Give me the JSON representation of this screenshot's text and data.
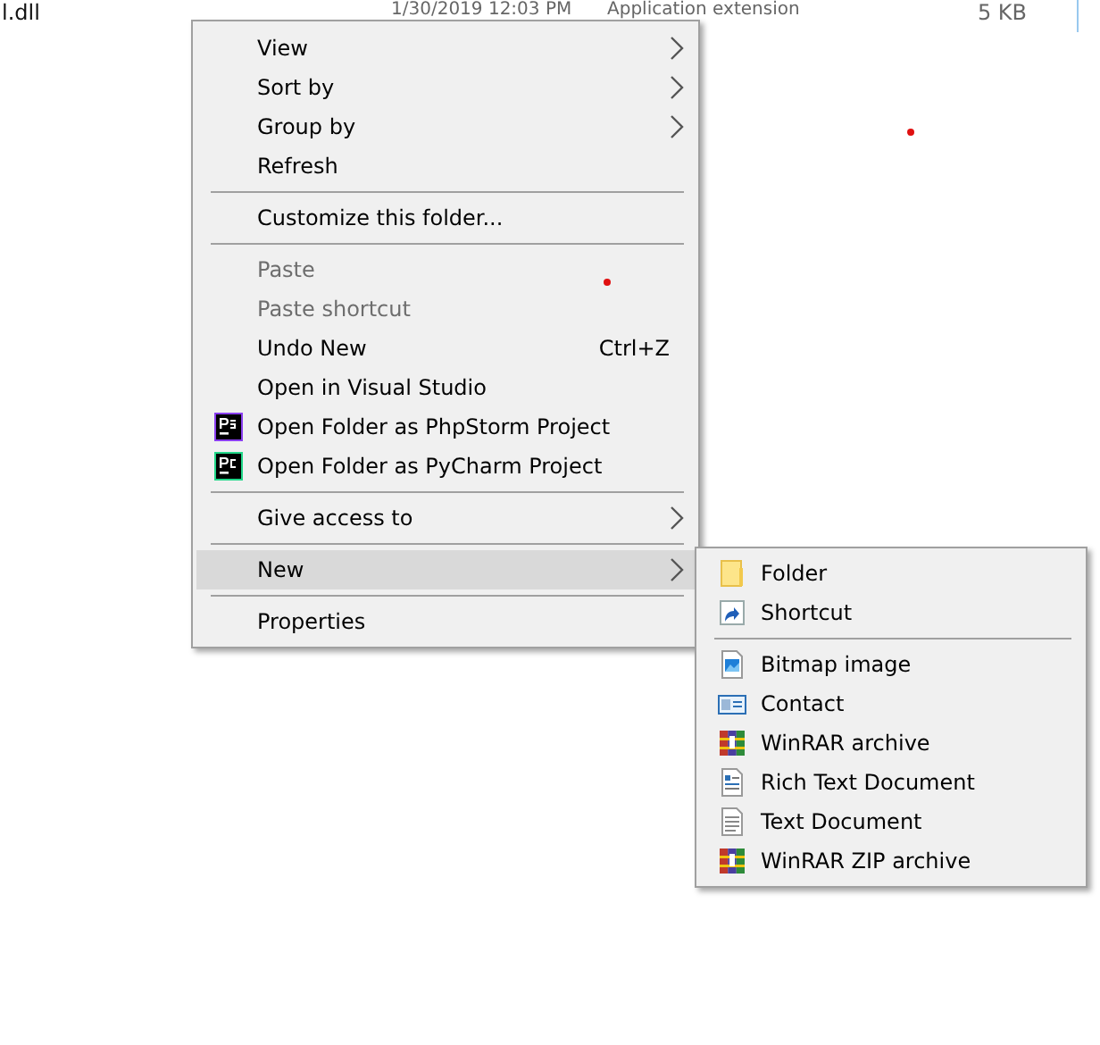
{
  "file_row": {
    "name": "l.dll",
    "date": "1/30/2019 12:03 PM",
    "type": "Application extension",
    "size": "5 KB"
  },
  "menu": {
    "items": [
      {
        "kind": "item",
        "label": "View",
        "submenu": true,
        "disabled": false,
        "selected": false
      },
      {
        "kind": "item",
        "label": "Sort by",
        "submenu": true,
        "disabled": false,
        "selected": false
      },
      {
        "kind": "item",
        "label": "Group by",
        "submenu": true,
        "disabled": false,
        "selected": false
      },
      {
        "kind": "item",
        "label": "Refresh",
        "submenu": false,
        "disabled": false,
        "selected": false
      },
      {
        "kind": "separator"
      },
      {
        "kind": "item",
        "label": "Customize this folder...",
        "submenu": false,
        "disabled": false,
        "selected": false
      },
      {
        "kind": "separator"
      },
      {
        "kind": "item",
        "label": "Paste",
        "submenu": false,
        "disabled": true,
        "selected": false
      },
      {
        "kind": "item",
        "label": "Paste shortcut",
        "submenu": false,
        "disabled": true,
        "selected": false
      },
      {
        "kind": "item",
        "label": "Undo New",
        "shortcut": "Ctrl+Z",
        "submenu": false,
        "disabled": false,
        "selected": false
      },
      {
        "kind": "item",
        "label": "Open in Visual Studio",
        "submenu": false,
        "disabled": false,
        "selected": false
      },
      {
        "kind": "item",
        "label": "Open Folder as PhpStorm Project",
        "submenu": false,
        "disabled": false,
        "selected": false
      },
      {
        "kind": "item",
        "label": "Open Folder as PyCharm Project",
        "submenu": false,
        "disabled": false,
        "selected": false
      },
      {
        "kind": "separator"
      },
      {
        "kind": "item",
        "label": "Give access to",
        "submenu": true,
        "disabled": false,
        "selected": false
      },
      {
        "kind": "separator"
      },
      {
        "kind": "item",
        "label": "New",
        "submenu": true,
        "disabled": false,
        "selected": true
      },
      {
        "kind": "separator"
      },
      {
        "kind": "item",
        "label": "Properties",
        "submenu": false,
        "disabled": false,
        "selected": false
      }
    ]
  },
  "submenu": {
    "items": [
      {
        "kind": "item",
        "label": "Folder"
      },
      {
        "kind": "item",
        "label": "Shortcut"
      },
      {
        "kind": "separator"
      },
      {
        "kind": "item",
        "label": "Bitmap image"
      },
      {
        "kind": "item",
        "label": "Contact"
      },
      {
        "kind": "item",
        "label": "WinRAR archive"
      },
      {
        "kind": "item",
        "label": "Rich Text Document"
      },
      {
        "kind": "item",
        "label": "Text Document"
      },
      {
        "kind": "item",
        "label": "WinRAR ZIP archive"
      }
    ]
  }
}
